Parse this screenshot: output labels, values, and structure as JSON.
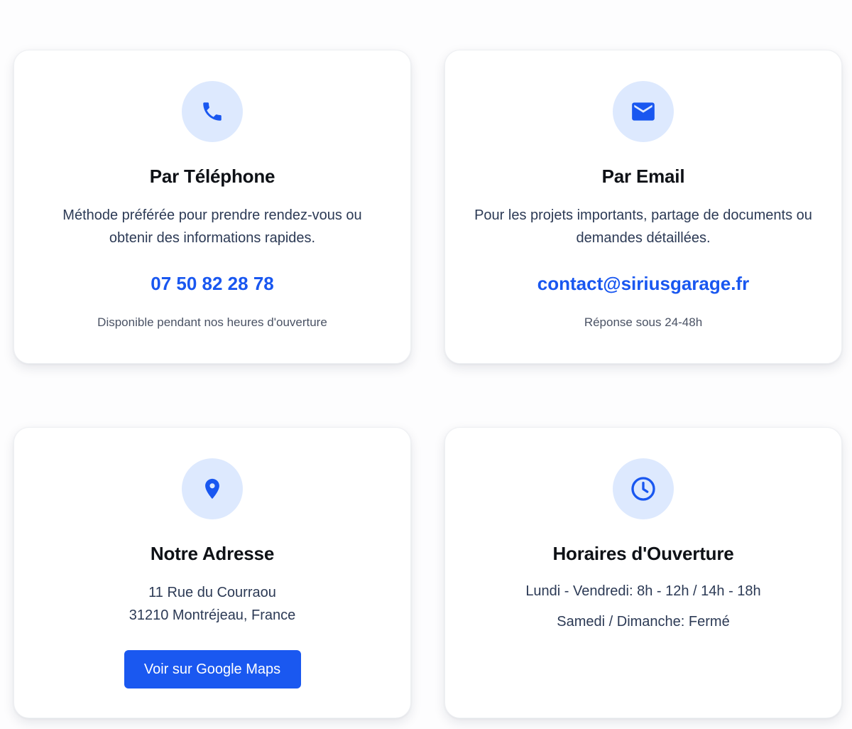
{
  "colors": {
    "accent": "#1957f0",
    "icon_bg": "#dde9fe",
    "title": "#0e1116",
    "text": "#2c3a55",
    "muted": "#4a5264"
  },
  "cards": {
    "phone": {
      "icon": "phone-icon",
      "title": "Par Téléphone",
      "description": "Méthode préférée pour prendre rendez-vous ou obtenir des informations rapides.",
      "link": "07 50 82 28 78",
      "note": "Disponible pendant nos heures d'ouverture"
    },
    "email": {
      "icon": "mail-icon",
      "title": "Par Email",
      "description": "Pour les projets importants, partage de documents ou demandes détaillées.",
      "link": "contact@siriusgarage.fr",
      "note": "Réponse sous 24-48h"
    },
    "address": {
      "icon": "map-pin-icon",
      "title": "Notre Adresse",
      "line1": "11 Rue du Courraou",
      "line2": "31210 Montréjeau, France",
      "button": "Voir sur Google Maps"
    },
    "hours": {
      "icon": "clock-icon",
      "title": "Horaires d'Ouverture",
      "weekday": "Lundi - Vendredi: 8h - 12h / 14h - 18h",
      "weekend": "Samedi / Dimanche: Fermé"
    }
  }
}
